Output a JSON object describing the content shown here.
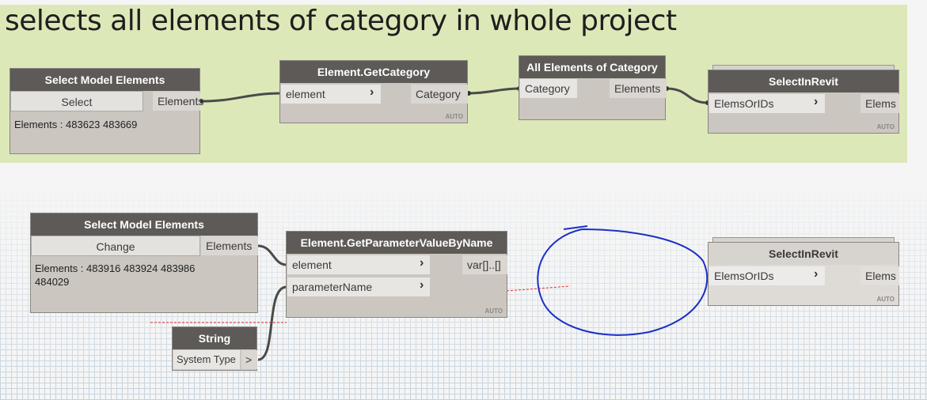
{
  "group": {
    "title": "selects all elements of category in whole project"
  },
  "node_select1": {
    "title": "Select Model Elements",
    "button": "Select",
    "output": "Elements",
    "info": "Elements : 483623 483669"
  },
  "node_getcat": {
    "title": "Element.GetCategory",
    "input": "element",
    "output": "Category",
    "auto": "AUTO"
  },
  "node_allcat": {
    "title": "All Elements of Category",
    "input": "Category",
    "output": "Elements"
  },
  "node_selrevit1": {
    "title": "SelectInRevit",
    "input": "ElemsOrIDs",
    "output": "Elems",
    "auto": "AUTO"
  },
  "node_select2": {
    "title": "Select Model Elements",
    "button": "Change",
    "output": "Elements",
    "info": "Elements : 483916 483924 483986\n484029"
  },
  "node_getparam": {
    "title": "Element.GetParameterValueByName",
    "input1": "element",
    "input2": "parameterName",
    "output": "var[]..[]",
    "auto": "AUTO"
  },
  "node_string": {
    "title": "String",
    "value": "System Type",
    "output": ">"
  },
  "node_selrevit2": {
    "title": "SelectInRevit",
    "input": "ElemsOrIDs",
    "output": "Elems",
    "auto": "AUTO"
  },
  "colors": {
    "group_bg": "#dde8b9",
    "node_header": "#5d5a57",
    "node_body": "#cbc6bf",
    "annotation": "#1a2fc7",
    "wire": "#4a4a4a"
  },
  "icons": {
    "chevron": "chevron-right-icon"
  }
}
